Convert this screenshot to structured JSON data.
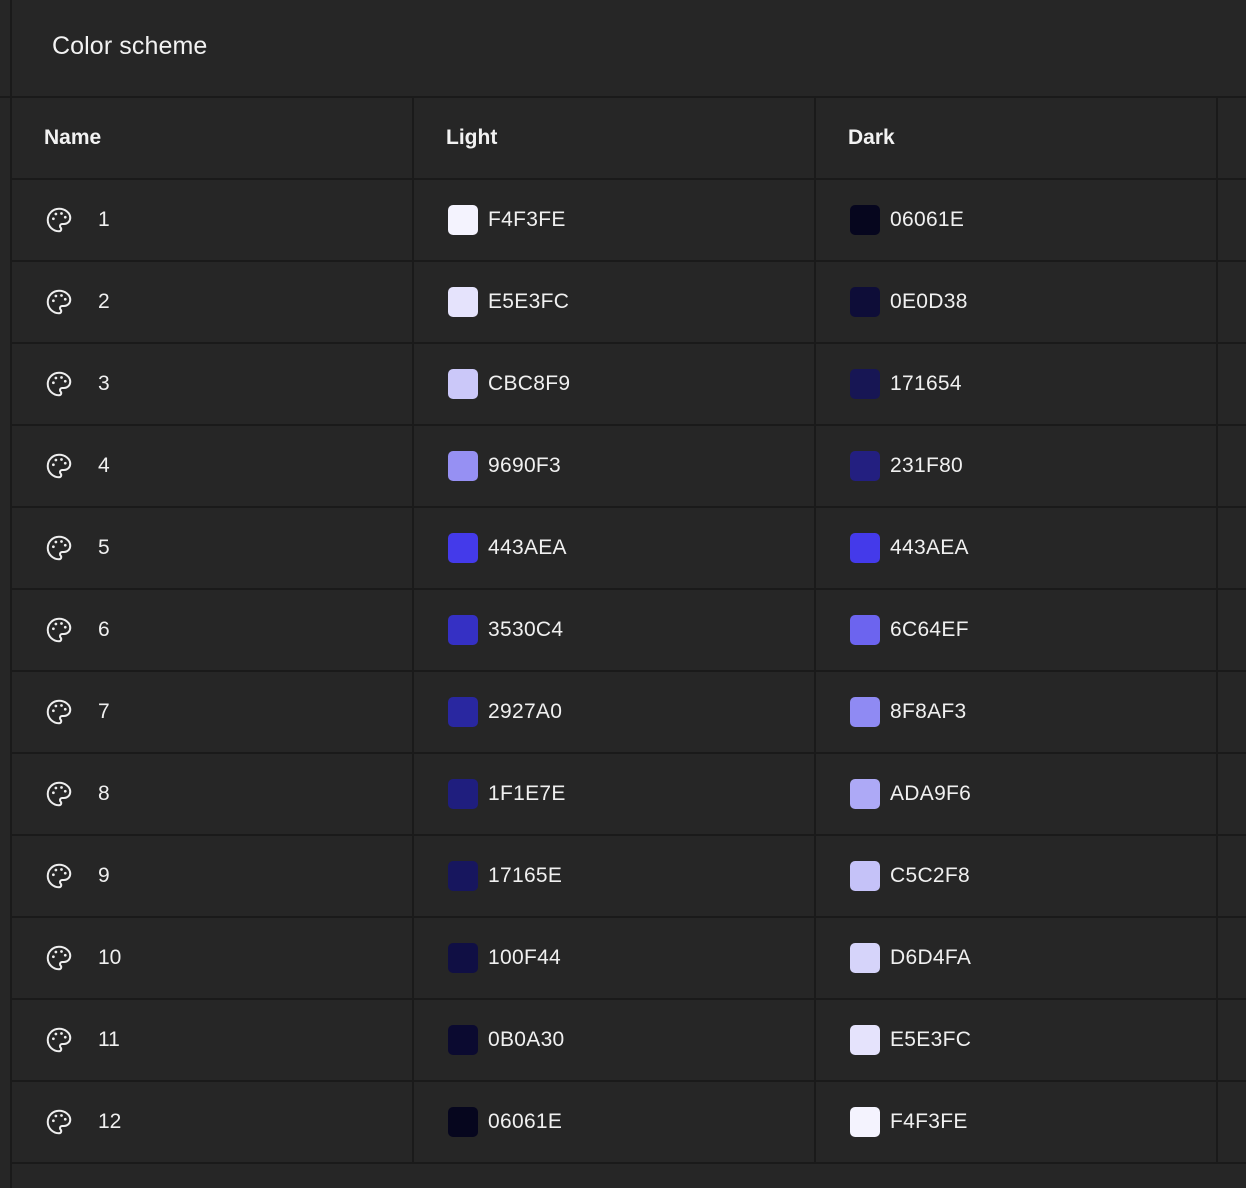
{
  "header": {
    "title": "Color scheme"
  },
  "table": {
    "columns": {
      "name": "Name",
      "light": "Light",
      "dark": "Dark"
    },
    "rows": [
      {
        "name": "1",
        "icon": "palette-icon",
        "light": "F4F3FE",
        "dark": "06061E"
      },
      {
        "name": "2",
        "icon": "palette-icon",
        "light": "E5E3FC",
        "dark": "0E0D38"
      },
      {
        "name": "3",
        "icon": "palette-icon",
        "light": "CBC8F9",
        "dark": "171654"
      },
      {
        "name": "4",
        "icon": "palette-icon",
        "light": "9690F3",
        "dark": "231F80"
      },
      {
        "name": "5",
        "icon": "palette-icon",
        "light": "443AEA",
        "dark": "443AEA"
      },
      {
        "name": "6",
        "icon": "palette-icon",
        "light": "3530C4",
        "dark": "6C64EF"
      },
      {
        "name": "7",
        "icon": "palette-icon",
        "light": "2927A0",
        "dark": "8F8AF3"
      },
      {
        "name": "8",
        "icon": "palette-icon",
        "light": "1F1E7E",
        "dark": "ADA9F6"
      },
      {
        "name": "9",
        "icon": "palette-icon",
        "light": "17165E",
        "dark": "C5C2F8"
      },
      {
        "name": "10",
        "icon": "palette-icon",
        "light": "100F44",
        "dark": "D6D4FA"
      },
      {
        "name": "11",
        "icon": "palette-icon",
        "light": "0B0A30",
        "dark": "E5E3FC"
      },
      {
        "name": "12",
        "icon": "palette-icon",
        "light": "06061E",
        "dark": "F4F3FE"
      }
    ]
  },
  "colors": {
    "background": "#262626",
    "divider": "#1a1a1a",
    "text": "#f0f0f0"
  }
}
